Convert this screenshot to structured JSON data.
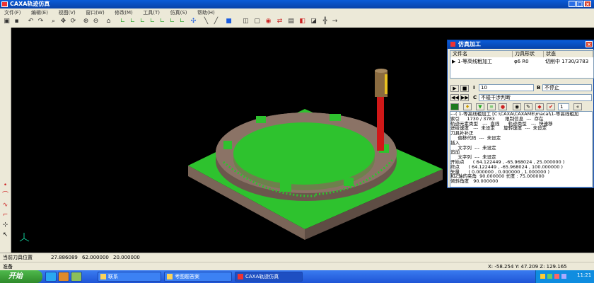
{
  "app": {
    "title": "CAXA轨迹仿真"
  },
  "menu": [
    "文件(F)",
    "编辑(E)",
    "视图(V)",
    "窗口(W)",
    "修改(M)",
    "工具(T)",
    "仿真(S)",
    "帮助(H)"
  ],
  "sim_window": {
    "title": "仿真加工",
    "columns": [
      "文件名",
      "刀具形状",
      "状态"
    ],
    "row": {
      "name": "1-等高线粗加工",
      "tool": "φ6 R0",
      "status": "切削中 1730/3783"
    },
    "speed_value": "10",
    "stop_option": "不停止",
    "check_option": "不碰干涉判断",
    "step_value": "1",
    "info_lines": [
      "---( 1-等高线粗加工 [C:\\CAXA\\CAXAME\\macal\\1-等高线粗加",
      "索引     1730 / 3783       限制信息  ---  存在",
      "轨迹元素类型   ---  直线      轨迹类型   ---  快速移",
      "进给速度   ---  未设定      旋转速度  ---  未设定",
      "刀具补补正",
      "     偏移代码  ---  未设定",
      "插入",
      "     文字列  ---  未设定",
      "追加",
      "     文字列  ---  未设定",
      "开始点      ( 64.122449 , -65.968024 , 25.000000 )",
      "终点      ( 64.122449 , -65.968024 , 100.000000 )",
      "矢量      ( 0.000000 , 0.000000 , 1.000000 )",
      "和Z轴的夹角  90.000000 长度 : 75.000000",
      "倾斜角度   90.000000"
    ]
  },
  "status": {
    "label": "当前刀具位置",
    "x": "27.886089",
    "y": "62.000000",
    "z": "20.000000",
    "ready": "准备",
    "coords": "X: -58.254 Y: 47.209 Z: 129.165"
  },
  "taskbar": {
    "start": "开始",
    "tasks": [
      "联系",
      "考图题答案",
      "CAXA轨迹仿真"
    ],
    "time": "11:21"
  },
  "colors": {
    "accent": "#0842a8",
    "stock": "#8b7366",
    "cut": "#22cc22",
    "tool": "#d01818"
  }
}
